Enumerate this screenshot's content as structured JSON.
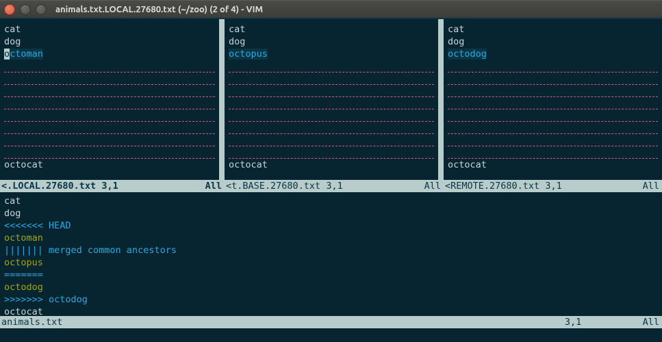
{
  "window": {
    "title": "animals.txt.LOCAL.27680.txt (~/zoo) (2 of 4) - VIM"
  },
  "panes": {
    "local": {
      "lines": [
        "cat",
        "dog",
        "octoman",
        "",
        "",
        "",
        "",
        "",
        "",
        "",
        "",
        "octocat"
      ],
      "diff_line_index": 2,
      "cursor": {
        "line": 2,
        "char": 0
      },
      "status_name": "<.LOCAL.27680.txt",
      "status_pos": "3,1",
      "status_pct": "All"
    },
    "base": {
      "lines": [
        "cat",
        "dog",
        "octopus",
        "",
        "",
        "",
        "",
        "",
        "",
        "",
        "",
        "octocat"
      ],
      "diff_line_index": 2,
      "status_name": "<t.BASE.27680.txt",
      "status_pos": "3,1",
      "status_pct": "All"
    },
    "remote": {
      "lines": [
        "cat",
        "dog",
        "octodog",
        "",
        "",
        "",
        "",
        "",
        "",
        "",
        "",
        "octocat"
      ],
      "diff_line_index": 2,
      "status_name": "<REMOTE.27680.txt",
      "status_pos": "3,1",
      "status_pct": "All"
    }
  },
  "merged": {
    "lines": [
      {
        "text": "cat",
        "cls": ""
      },
      {
        "text": "dog",
        "cls": ""
      },
      {
        "text": "<<<<<<< HEAD",
        "cls": "blue"
      },
      {
        "text": "octoman",
        "cls": "olive"
      },
      {
        "text": "||||||| merged common ancestors",
        "cls": "blue"
      },
      {
        "text": "octopus",
        "cls": "olive"
      },
      {
        "text": "=======",
        "cls": "blue"
      },
      {
        "text": "octodog",
        "cls": "olive"
      },
      {
        "text": ">>>>>>> octodog",
        "cls": "blue"
      },
      {
        "text": "octocat",
        "cls": ""
      }
    ],
    "status_name": "animals.txt",
    "status_pos": "3,1",
    "status_pct": "All"
  }
}
